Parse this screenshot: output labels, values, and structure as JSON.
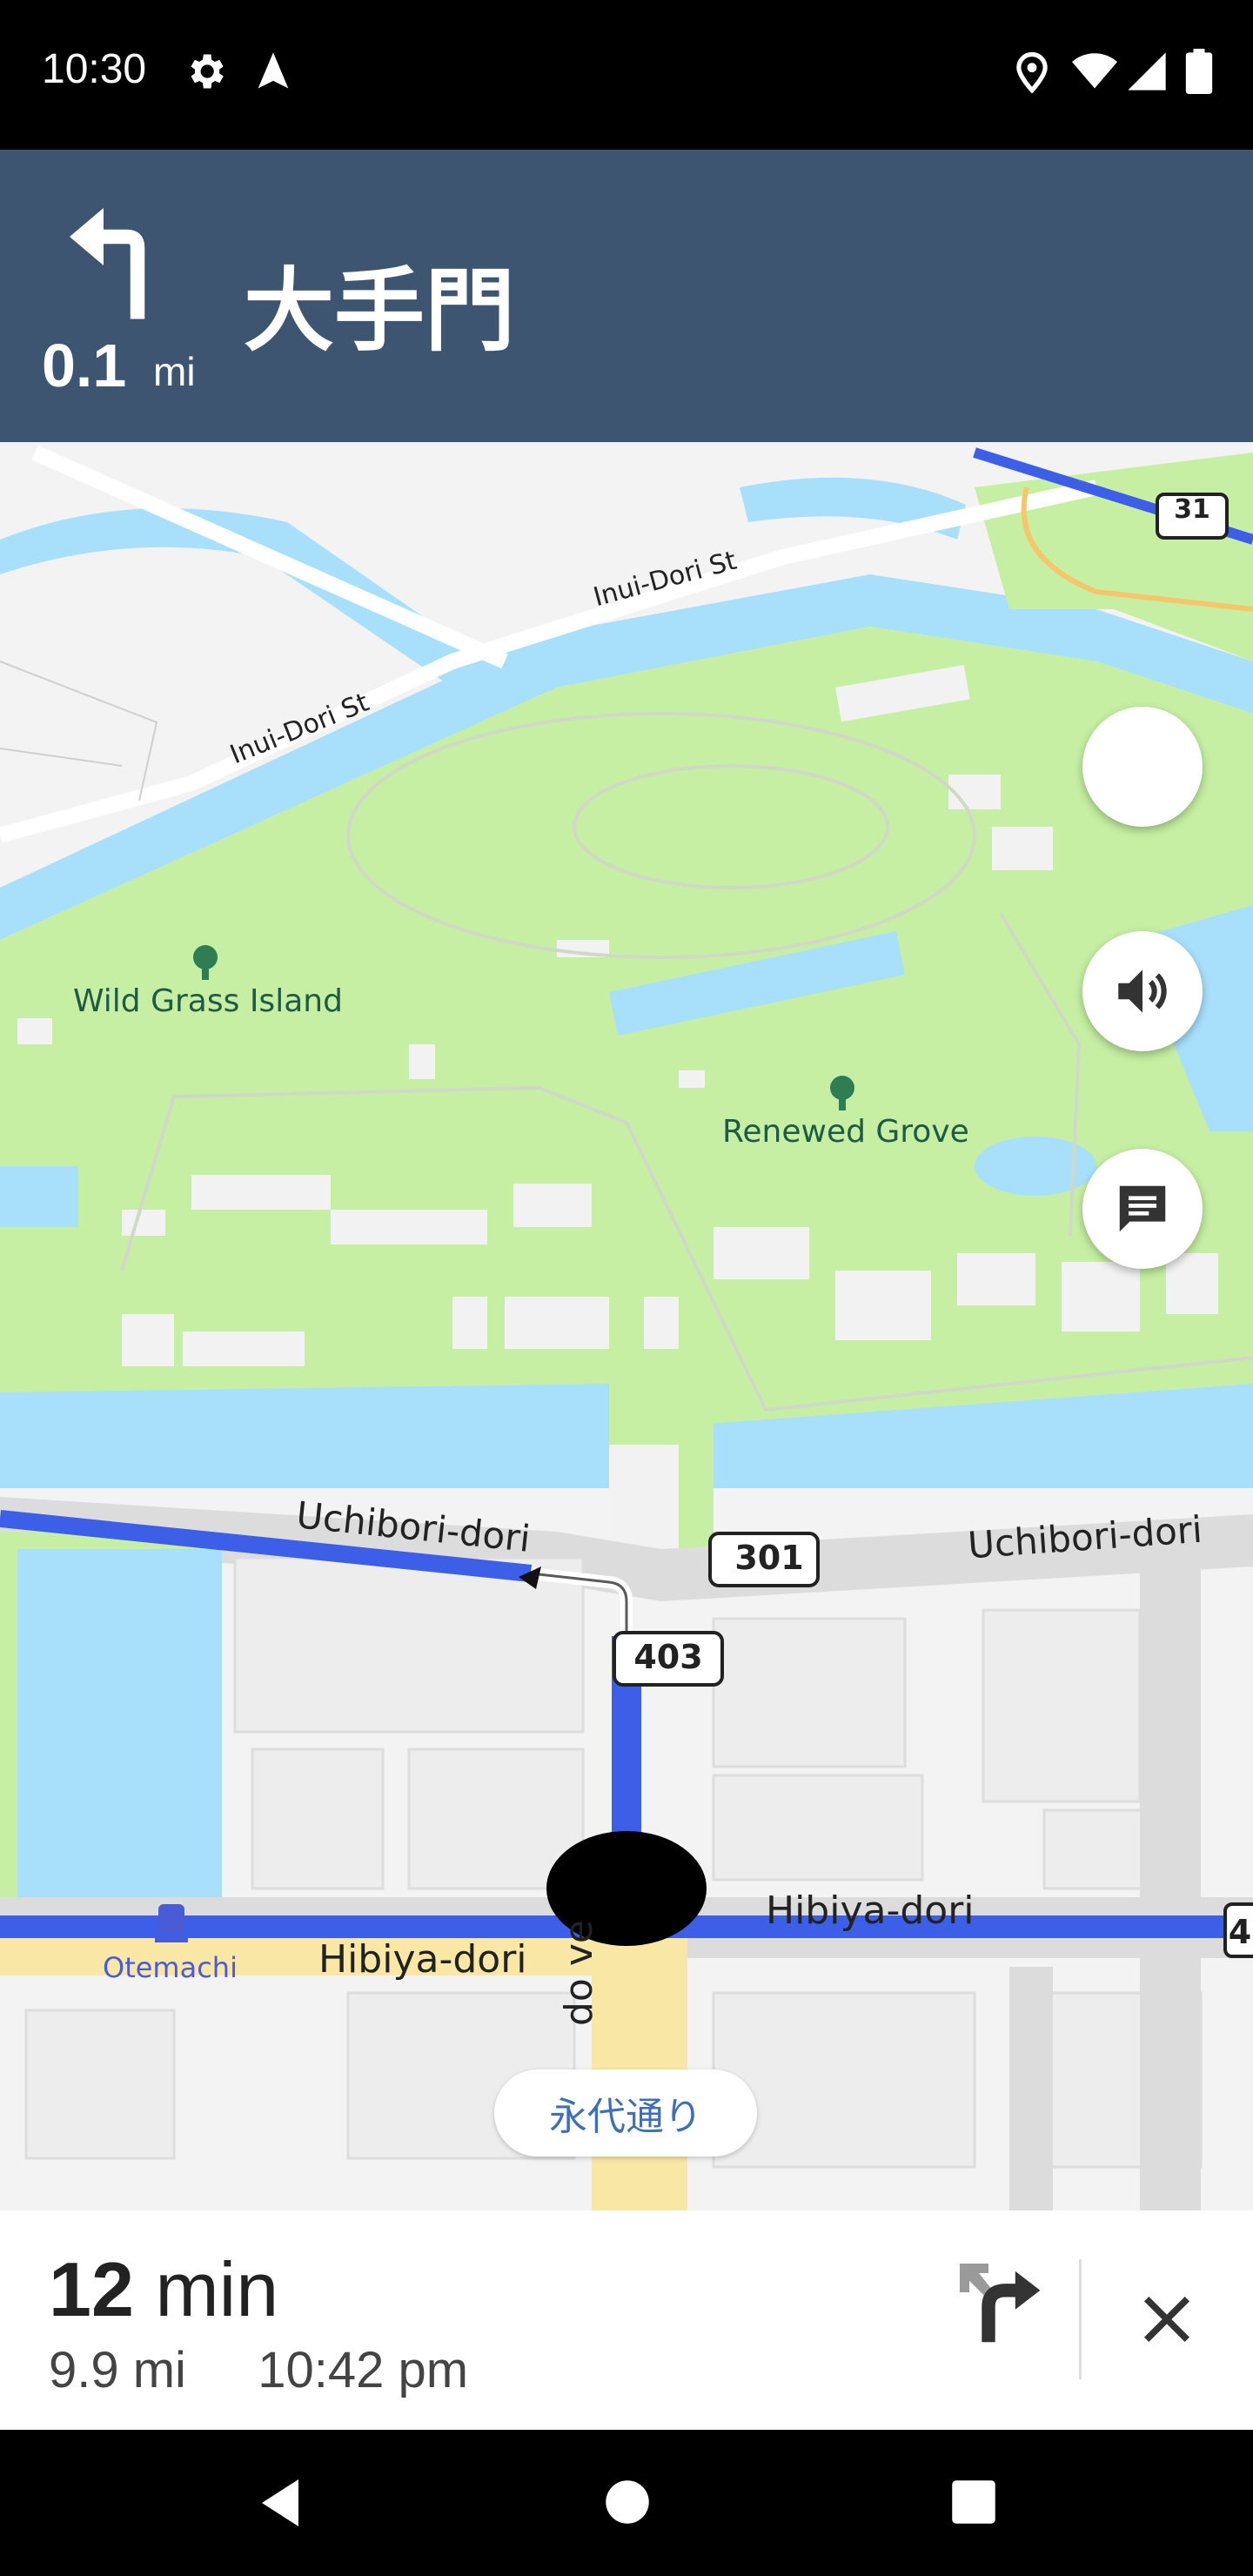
{
  "status_bar": {
    "time": "10:30",
    "icons": [
      "gear-icon",
      "navigation-arrow-icon",
      "location-pin-icon",
      "wifi-icon",
      "signal-icon",
      "battery-icon"
    ]
  },
  "nav_header": {
    "distance": "0.1",
    "distance_unit": "mi",
    "street": "大手門",
    "turn_icon": "turn-left-icon",
    "bg_color": "#3d5570"
  },
  "map": {
    "labels": {
      "inui_dori_1": "Inui-Dori St",
      "inui_dori_2": "Inui-Dori St",
      "wild_grass_island": "Wild Grass Island",
      "renewed_grove": "Renewed Grove",
      "uchibori_dori_1": "Uchibori-dori",
      "uchibori_dori_2": "Uchibori-dori",
      "hibiya_dori_1": "Hibiya-dori",
      "hibiya_dori_2": "Hibiya-dori",
      "otemachi": "Otemachi",
      "route_301": "301",
      "route_403": "403",
      "route_31": "31",
      "route_4": "4",
      "avenue_partial": "do  ve",
      "eidai_dori": "永代通り"
    },
    "route_color": "#3d5fe8",
    "water_color": "#a8e0fb",
    "park_color": "#c6efa3"
  },
  "controls": {
    "sound": "volume-icon",
    "messages": "chat-icon"
  },
  "bottom_panel": {
    "minutes": "12",
    "minutes_unit": "min",
    "distance": "9.9 mi",
    "arrival": "10:42 pm"
  }
}
